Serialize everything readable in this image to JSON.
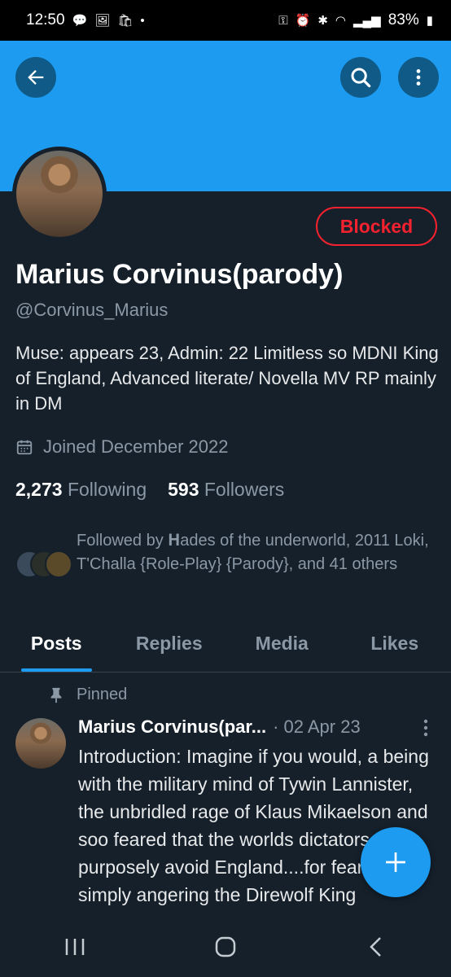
{
  "status_bar": {
    "time": "12:50",
    "battery": "83%"
  },
  "profile": {
    "name": "Marius Corvinus(parody)",
    "handle": "@Corvinus_Marius",
    "blocked_label": "Blocked",
    "bio": "Muse: appears 23, Admin: 22 Limitless so MDNI  King of England, Advanced literate/ Novella MV RP mainly in DM",
    "joined": "Joined December 2022",
    "following_count": "2,273",
    "following_label": "Following",
    "followers_count": "593",
    "followers_label": "Followers",
    "followed_by": "Followed by    𝐇ades of the underworld, 2011 Loki, T'Challa {Role-Play} {Parody}, and 41 others"
  },
  "tabs": [
    {
      "label": "Posts",
      "active": true
    },
    {
      "label": "Replies",
      "active": false
    },
    {
      "label": "Media",
      "active": false
    },
    {
      "label": "Likes",
      "active": false
    }
  ],
  "pinned_post": {
    "pinned_label": "Pinned",
    "author": "Marius Corvinus(par...",
    "date": "· 02 Apr 23",
    "text": "Introduction: Imagine if you would, a being with the military mind of Tywin Lannister, the unbridled rage of Klaus Mikaelson and soo feared that the worlds dictators purposely avoid England....for fear of simply angering the Direwolf King"
  },
  "icons": {
    "back": "arrow-left-icon",
    "search": "search-icon",
    "more": "more-vertical-icon",
    "calendar": "calendar-icon",
    "pin": "pin-icon",
    "compose": "plus-icon"
  },
  "colors": {
    "accent": "#1d9bf0",
    "background": "#15202b",
    "blocked": "#f4212e",
    "muted": "#8b98a5"
  }
}
